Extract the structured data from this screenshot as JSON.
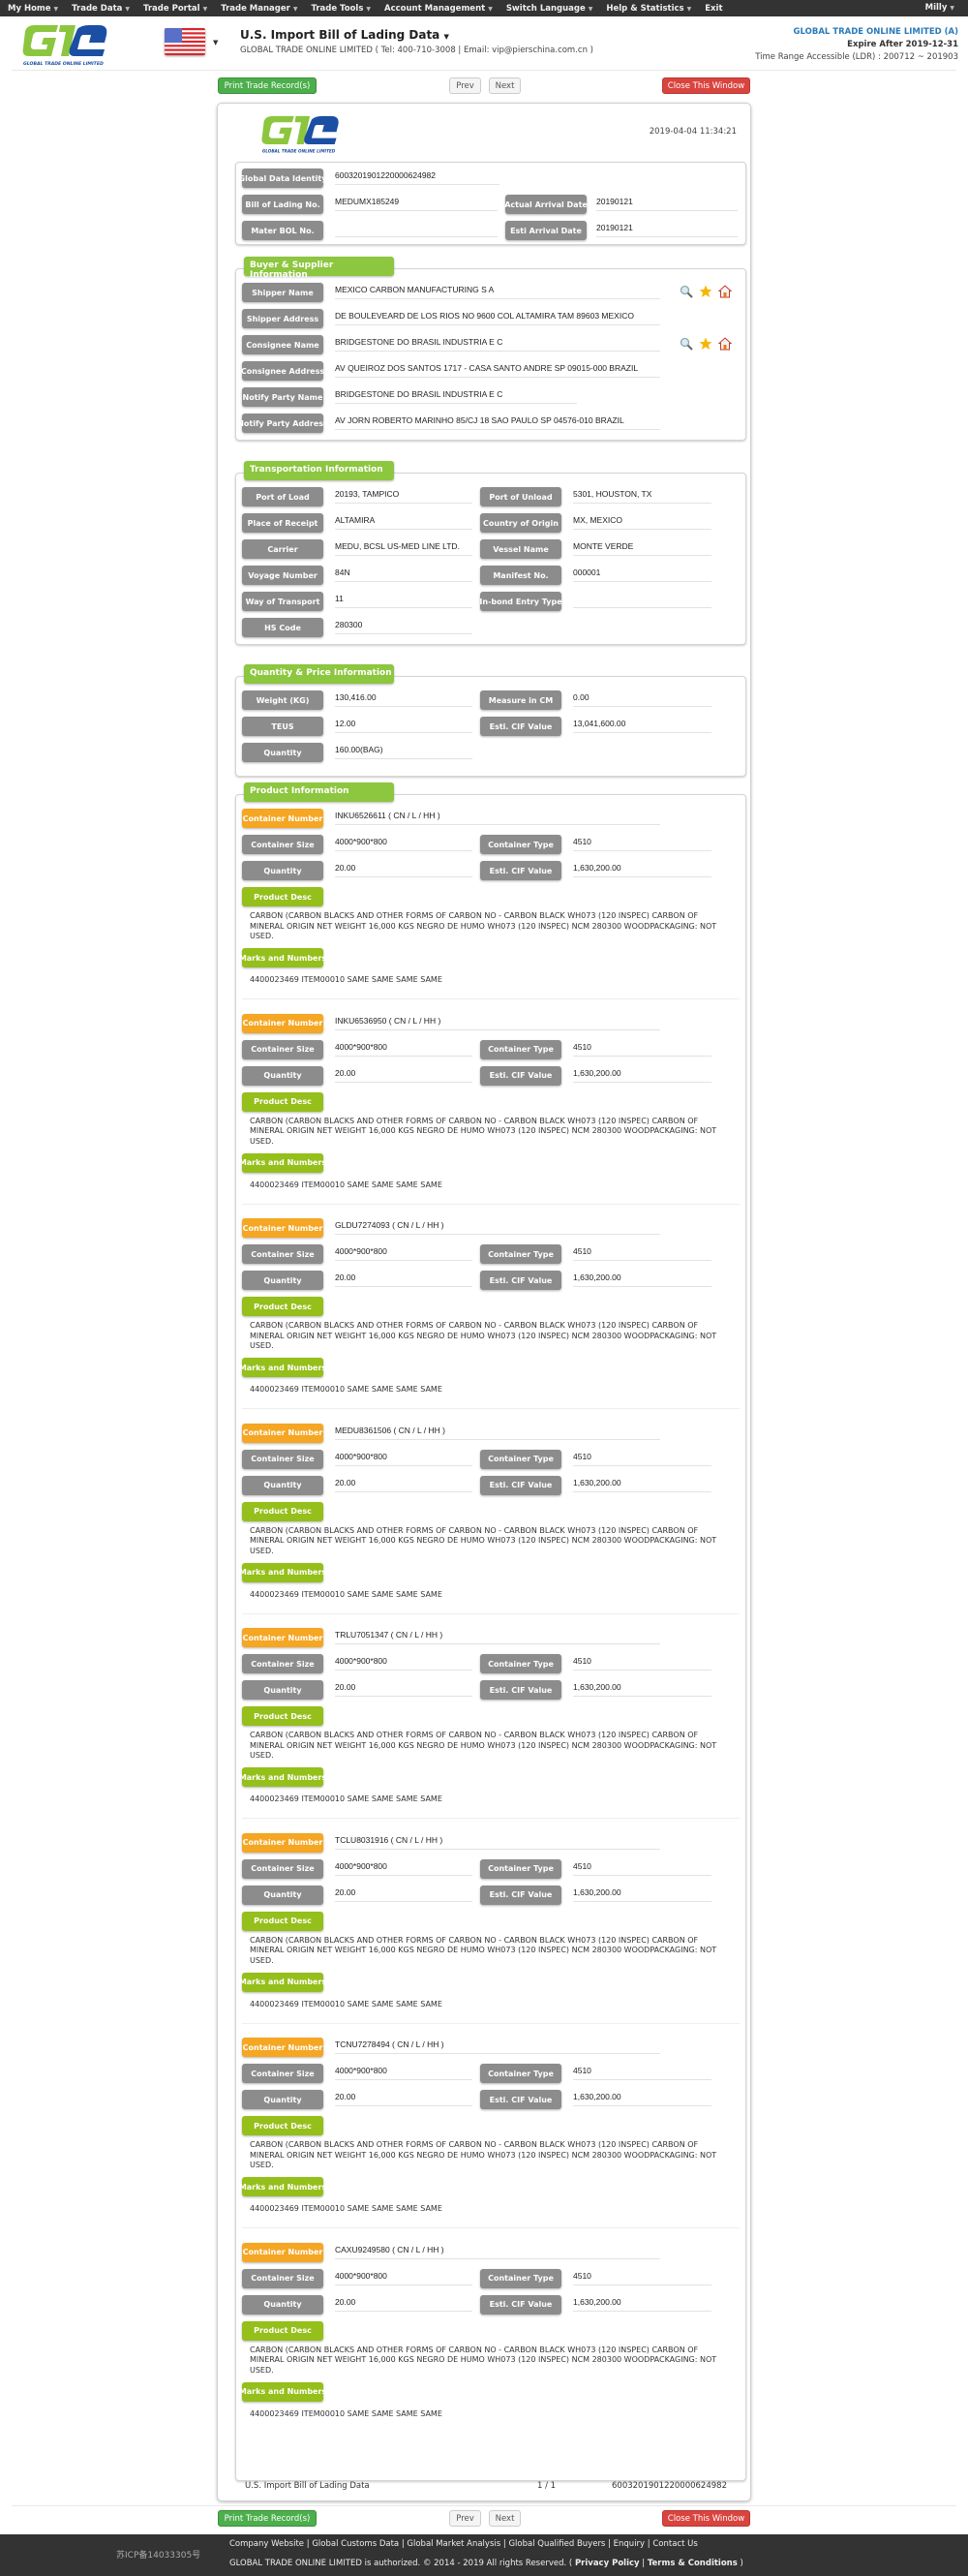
{
  "nav": {
    "items": [
      "My Home",
      "Trade Data",
      "Trade Portal",
      "Trade Manager",
      "Trade Tools",
      "Account Management",
      "Switch Language",
      "Help & Statistics",
      "Exit"
    ],
    "user": "Milly"
  },
  "header": {
    "logo_text": "GLOBAL TRADE ONLINE LIMITED",
    "title": "U.S. Import Bill of Lading Data",
    "subtitle": "GLOBAL TRADE ONLINE LIMITED ( Tel: 400-710-3008 | Email: vip@pierschina.com.cn )",
    "account": {
      "company": "GLOBAL TRADE ONLINE LIMITED (A)",
      "expire": "Expire After 2019-12-31",
      "range": "Time Range Accessible (LDR) : 200712 ~ 201903"
    }
  },
  "buttons": {
    "print": "Print Trade Record(s)",
    "prev": "Prev",
    "next": "Next",
    "close": "Close This Window"
  },
  "record": {
    "timestamp": "2019-04-04 11:34:21",
    "ids": {
      "global_data_identity_label": "Global Data Identity",
      "global_data_identity": "6003201901220000624982",
      "bol_label": "Bill of Lading No.",
      "bol": "MEDUMX185249",
      "actual_arrival_label": "Actual Arrival Date",
      "actual_arrival": "20190121",
      "master_bol_label": "Mater BOL No.",
      "master_bol": "",
      "esti_arrival_label": "Esti Arrival Date",
      "esti_arrival": "20190121"
    },
    "buyer_supplier": {
      "title": "Buyer & Supplier Information",
      "rows": [
        {
          "label": "Shipper Name",
          "value": "MEXICO CARBON MANUFACTURING S A",
          "icons": true
        },
        {
          "label": "Shipper Address",
          "value": "DE BOULEVEARD DE LOS RIOS NO 9600 COL ALTAMIRA TAM 89603 MEXICO",
          "icons": false
        },
        {
          "label": "Consignee Name",
          "value": "BRIDGESTONE DO BRASIL INDUSTRIA E C",
          "icons": true
        },
        {
          "label": "Consignee Address",
          "value": "AV QUEIROZ DOS SANTOS 1717 - CASA SANTO ANDRE SP 09015-000 BRAZIL",
          "icons": false
        },
        {
          "label": "Notify Party Name",
          "value": "BRIDGESTONE DO BRASIL INDUSTRIA E C",
          "icons": false
        },
        {
          "label": "Notify Party Address",
          "value": "AV JORN ROBERTO MARINHO 85/CJ 18 SAO PAULO SP 04576-010 BRAZIL",
          "icons": false
        }
      ]
    },
    "transport": {
      "title": "Transportation Information",
      "rows": [
        [
          {
            "label": "Port of Load",
            "value": "20193, TAMPICO"
          },
          {
            "label": "Port of Unload",
            "value": "5301, HOUSTON, TX"
          }
        ],
        [
          {
            "label": "Place of Receipt",
            "value": "ALTAMIRA"
          },
          {
            "label": "Country of Origin",
            "value": "MX, MEXICO"
          }
        ],
        [
          {
            "label": "Carrier",
            "value": "MEDU, BCSL US-MED LINE LTD."
          },
          {
            "label": "Vessel Name",
            "value": "MONTE VERDE"
          }
        ],
        [
          {
            "label": "Voyage Number",
            "value": "84N"
          },
          {
            "label": "Manifest No.",
            "value": "000001"
          }
        ],
        [
          {
            "label": "Way of Transport",
            "value": "11"
          },
          {
            "label": "In-bond Entry Type",
            "value": ""
          }
        ],
        [
          {
            "label": "HS Code",
            "value": "280300"
          }
        ]
      ]
    },
    "quantity": {
      "title": "Quantity & Price Information",
      "rows": [
        [
          {
            "label": "Weight (KG)",
            "value": "130,416.00"
          },
          {
            "label": "Measure in CM",
            "value": "0.00"
          }
        ],
        [
          {
            "label": "TEUS",
            "value": "12.00"
          },
          {
            "label": "Esti. CIF Value",
            "value": "13,041,600.00"
          }
        ],
        [
          {
            "label": "Quantity",
            "value": "160.00(BAG)"
          }
        ]
      ]
    },
    "product": {
      "title": "Product Information",
      "labels": {
        "container_number": "Container Number",
        "container_size": "Container Size",
        "container_type": "Container Type",
        "quantity": "Quantity",
        "cif": "Esti. CIF Value",
        "desc": "Product Desc",
        "marks": "Marks and Numbers"
      },
      "containers": [
        {
          "number": "INKU6526611 ( CN / L / HH )",
          "size": "4000*900*800",
          "type": "4510",
          "quantity": "20.00",
          "cif": "1,630,200.00",
          "desc": "CARBON (CARBON BLACKS AND OTHER FORMS OF CARBON NO - CARBON BLACK WH073 (120 INSPEC) CARBON OF MINERAL ORIGIN NET WEIGHT 16,000 KGS NEGRO DE HUMO WH073 (120 INSPEC) NCM 280300 WOODPACKAGING: NOT USED.",
          "marks": "4400023469 ITEM00010 SAME SAME SAME SAME"
        },
        {
          "number": "INKU6536950 ( CN / L / HH )",
          "size": "4000*900*800",
          "type": "4510",
          "quantity": "20.00",
          "cif": "1,630,200.00",
          "desc": "CARBON (CARBON BLACKS AND OTHER FORMS OF CARBON NO - CARBON BLACK WH073 (120 INSPEC) CARBON OF MINERAL ORIGIN NET WEIGHT 16,000 KGS NEGRO DE HUMO WH073 (120 INSPEC) NCM 280300 WOODPACKAGING: NOT USED.",
          "marks": "4400023469 ITEM00010 SAME SAME SAME SAME"
        },
        {
          "number": "GLDU7274093 ( CN / L / HH )",
          "size": "4000*900*800",
          "type": "4510",
          "quantity": "20.00",
          "cif": "1,630,200.00",
          "desc": "CARBON (CARBON BLACKS AND OTHER FORMS OF CARBON NO - CARBON BLACK WH073 (120 INSPEC) CARBON OF MINERAL ORIGIN NET WEIGHT 16,000 KGS NEGRO DE HUMO WH073 (120 INSPEC) NCM 280300 WOODPACKAGING: NOT USED.",
          "marks": "4400023469 ITEM00010 SAME SAME SAME SAME"
        },
        {
          "number": "MEDU8361506 ( CN / L / HH )",
          "size": "4000*900*800",
          "type": "4510",
          "quantity": "20.00",
          "cif": "1,630,200.00",
          "desc": "CARBON (CARBON BLACKS AND OTHER FORMS OF CARBON NO - CARBON BLACK WH073 (120 INSPEC) CARBON OF MINERAL ORIGIN NET WEIGHT 16,000 KGS NEGRO DE HUMO WH073 (120 INSPEC) NCM 280300 WOODPACKAGING: NOT USED.",
          "marks": "4400023469 ITEM00010 SAME SAME SAME SAME"
        },
        {
          "number": "TRLU7051347 ( CN / L / HH )",
          "size": "4000*900*800",
          "type": "4510",
          "quantity": "20.00",
          "cif": "1,630,200.00",
          "desc": "CARBON (CARBON BLACKS AND OTHER FORMS OF CARBON NO - CARBON BLACK WH073 (120 INSPEC) CARBON OF MINERAL ORIGIN NET WEIGHT 16,000 KGS NEGRO DE HUMO WH073 (120 INSPEC) NCM 280300 WOODPACKAGING: NOT USED.",
          "marks": "4400023469 ITEM00010 SAME SAME SAME SAME"
        },
        {
          "number": "TCLU8031916 ( CN / L / HH )",
          "size": "4000*900*800",
          "type": "4510",
          "quantity": "20.00",
          "cif": "1,630,200.00",
          "desc": "CARBON (CARBON BLACKS AND OTHER FORMS OF CARBON NO - CARBON BLACK WH073 (120 INSPEC) CARBON OF MINERAL ORIGIN NET WEIGHT 16,000 KGS NEGRO DE HUMO WH073 (120 INSPEC) NCM 280300 WOODPACKAGING: NOT USED.",
          "marks": "4400023469 ITEM00010 SAME SAME SAME SAME"
        },
        {
          "number": "TCNU7278494 ( CN / L / HH )",
          "size": "4000*900*800",
          "type": "4510",
          "quantity": "20.00",
          "cif": "1,630,200.00",
          "desc": "CARBON (CARBON BLACKS AND OTHER FORMS OF CARBON NO - CARBON BLACK WH073 (120 INSPEC) CARBON OF MINERAL ORIGIN NET WEIGHT 16,000 KGS NEGRO DE HUMO WH073 (120 INSPEC) NCM 280300 WOODPACKAGING: NOT USED.",
          "marks": "4400023469 ITEM00010 SAME SAME SAME SAME"
        },
        {
          "number": "CAXU9249580 ( CN / L / HH )",
          "size": "4000*900*800",
          "type": "4510",
          "quantity": "20.00",
          "cif": "1,630,200.00",
          "desc": "CARBON (CARBON BLACKS AND OTHER FORMS OF CARBON NO - CARBON BLACK WH073 (120 INSPEC) CARBON OF MINERAL ORIGIN NET WEIGHT 16,000 KGS NEGRO DE HUMO WH073 (120 INSPEC) NCM 280300 WOODPACKAGING: NOT USED.",
          "marks": "4400023469 ITEM00010 SAME SAME SAME SAME"
        }
      ]
    },
    "pager": {
      "source": "U.S. Import Bill of Lading Data",
      "page": "1 / 1",
      "id": "6003201901220000624982"
    }
  },
  "footer": {
    "icp": "苏ICP备14033305号",
    "links": [
      "Company Website",
      "Global Customs Data",
      "Global Market Analysis",
      "Global Qualified Buyers",
      "Enquiry",
      "Contact Us"
    ],
    "copyright": "GLOBAL TRADE ONLINE LIMITED is authorized. © 2014 - 2019 All rights Reserved.",
    "policy_links": [
      "Privacy Policy",
      "Terms & Conditions"
    ]
  },
  "colors": {
    "nav_bg": "#333333",
    "section_green": "#8dc63f",
    "label_gray": "#8c8c8c",
    "container_orange": "#f5a623",
    "desc_green": "#95bf1a",
    "print_green": "#4cae4c",
    "close_red": "#d9443f",
    "account_blue": "#2a7ab8"
  }
}
